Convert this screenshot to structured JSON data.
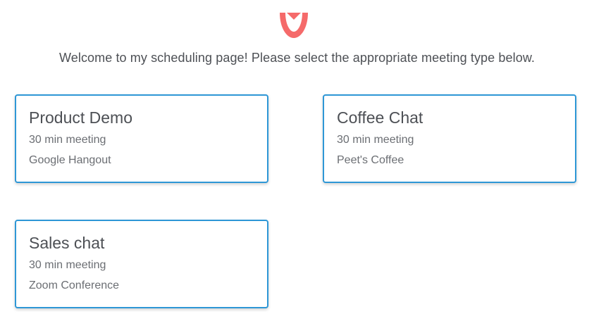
{
  "header": {
    "logo_icon": "heart-shield-logo",
    "logo_color": "#f56a6a",
    "welcome_text": "Welcome to my scheduling page! Please select the appropriate meeting type below."
  },
  "meeting_types": [
    {
      "title": "Product Demo",
      "duration": "30 min meeting",
      "location": "Google Hangout"
    },
    {
      "title": "Coffee Chat",
      "duration": "30 min meeting",
      "location": "Peet's Coffee"
    },
    {
      "title": "Sales chat",
      "duration": "30 min meeting",
      "location": "Zoom Conference"
    }
  ],
  "colors": {
    "card_border": "#2e97d6",
    "text_primary": "#4d5055",
    "text_secondary": "#6b6e73"
  }
}
